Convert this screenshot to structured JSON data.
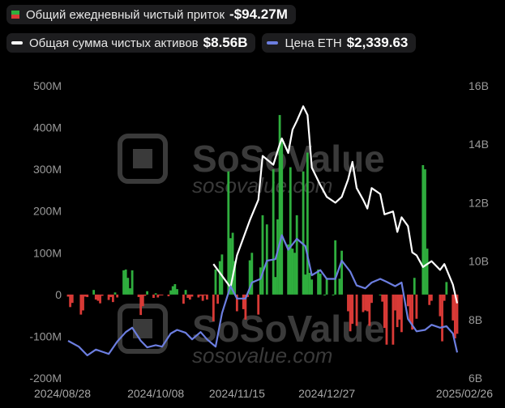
{
  "legend": {
    "flow": {
      "label": "Общий ежедневный чистый приток",
      "value": "-$94.27M",
      "color_pos": "#2fae3e",
      "color_neg": "#d93a36"
    },
    "assets": {
      "label": "Общая сумма чистых активов",
      "value": "$8.56B",
      "color": "#ffffff"
    },
    "price": {
      "label": "Цена ETH",
      "value": "$2,339.63",
      "color": "#6c7ee0"
    }
  },
  "watermark": {
    "brand": "SoSoValue",
    "url": "sosovalue.com"
  },
  "chart_data": {
    "type": "bar",
    "title": "",
    "x_tick_labels": [
      "2024/08/28",
      "2024/10/08",
      "2024/11/15",
      "2024/12/27",
      "2025/02/26"
    ],
    "left_axis": {
      "ticks": [
        "500M",
        "400M",
        "300M",
        "200M",
        "100M",
        "0",
        "-100M",
        "-200M"
      ],
      "ylim": [
        -200,
        500
      ],
      "unit": "M USD"
    },
    "right_axis": {
      "ticks": [
        "16B",
        "14B",
        "12B",
        "10B",
        "8B",
        "6B"
      ],
      "ylim": [
        6,
        16
      ],
      "unit": "B USD"
    },
    "grid": false,
    "series": [
      {
        "name": "Общий ежедневный чистый приток",
        "kind": "bar",
        "unit": "M USD",
        "x": [
          "2024-08-28",
          "2024-08-29",
          "2024-08-30",
          "2024-09-03",
          "2024-09-04",
          "2024-09-05",
          "2024-09-06",
          "2024-09-09",
          "2024-09-10",
          "2024-09-11",
          "2024-09-12",
          "2024-09-13",
          "2024-09-16",
          "2024-09-17",
          "2024-09-18",
          "2024-09-19",
          "2024-09-20",
          "2024-09-23",
          "2024-09-24",
          "2024-09-25",
          "2024-09-26",
          "2024-09-27",
          "2024-09-30",
          "2024-10-01",
          "2024-10-02",
          "2024-10-03",
          "2024-10-04",
          "2024-10-07",
          "2024-10-08",
          "2024-10-09",
          "2024-10-10",
          "2024-10-11",
          "2024-10-14",
          "2024-10-15",
          "2024-10-16",
          "2024-10-17",
          "2024-10-18",
          "2024-10-21",
          "2024-10-22",
          "2024-10-23",
          "2024-10-24",
          "2024-10-25",
          "2024-10-28",
          "2024-10-29",
          "2024-10-30",
          "2024-10-31",
          "2024-11-01",
          "2024-11-04",
          "2024-11-05",
          "2024-11-06",
          "2024-11-07",
          "2024-11-08",
          "2024-11-11",
          "2024-11-12",
          "2024-11-13",
          "2024-11-14",
          "2024-11-15",
          "2024-11-18",
          "2024-11-19",
          "2024-11-20",
          "2024-11-21",
          "2024-11-22",
          "2024-11-25",
          "2024-11-26",
          "2024-11-27",
          "2024-11-29",
          "2024-12-02",
          "2024-12-03",
          "2024-12-04",
          "2024-12-05",
          "2024-12-06",
          "2024-12-09",
          "2024-12-10",
          "2024-12-11",
          "2024-12-12",
          "2024-12-13",
          "2024-12-16",
          "2024-12-17",
          "2024-12-18",
          "2024-12-19",
          "2024-12-20",
          "2024-12-23",
          "2024-12-24",
          "2024-12-26",
          "2024-12-27",
          "2024-12-30",
          "2024-12-31",
          "2025-01-02",
          "2025-01-03",
          "2025-01-06",
          "2025-01-07",
          "2025-01-08",
          "2025-01-10",
          "2025-01-13",
          "2025-01-14",
          "2025-01-15",
          "2025-01-16",
          "2025-01-17",
          "2025-01-21",
          "2025-01-22",
          "2025-01-23",
          "2025-01-24",
          "2025-01-27",
          "2025-01-28",
          "2025-01-29",
          "2025-01-30",
          "2025-01-31",
          "2025-02-03",
          "2025-02-04",
          "2025-02-05",
          "2025-02-06",
          "2025-02-07",
          "2025-02-10",
          "2025-02-11",
          "2025-02-12",
          "2025-02-13",
          "2025-02-14",
          "2025-02-18",
          "2025-02-19",
          "2025-02-20",
          "2025-02-21",
          "2025-02-24",
          "2025-02-25",
          "2025-02-26"
        ],
        "values": [
          -5,
          -30,
          -20,
          -48,
          -38,
          -5,
          -6,
          11,
          -12,
          -15,
          -21,
          -3,
          -13,
          -6,
          -18,
          5,
          -7,
          58,
          60,
          40,
          15,
          58,
          -6,
          -49,
          -28,
          -3,
          8,
          -8,
          3,
          -7,
          -2,
          -1,
          -4,
          10,
          20,
          25,
          13,
          -22,
          11,
          -8,
          -12,
          -5,
          -7,
          -3,
          -15,
          -2,
          -12,
          -64,
          60,
          -22,
          80,
          96,
          295,
          135,
          148,
          80,
          -40,
          -35,
          -60,
          -6,
          82,
          100,
          -48,
          65,
          190,
          168,
          300,
          42,
          180,
          430,
          370,
          120,
          305,
          110,
          100,
          190,
          295,
          48,
          340,
          52,
          36,
          60,
          50,
          0,
          40,
          0,
          130,
          38,
          105,
          -40,
          -88,
          -70,
          -75,
          -42,
          -38,
          -40,
          -75,
          -20,
          0,
          -17,
          -80,
          -120,
          -120,
          -38,
          -78,
          -60,
          -90,
          -28,
          -65,
          -84,
          40,
          -58,
          310,
          300,
          110,
          -25,
          -15,
          -52,
          -112,
          -15,
          30,
          -62,
          -105,
          -94
        ]
      },
      {
        "name": "Общая сумма чистых активов",
        "kind": "line",
        "unit": "B USD",
        "x": [
          "2024-11-04",
          "2024-11-08",
          "2024-11-12",
          "2024-11-15",
          "2024-11-18",
          "2024-11-21",
          "2024-11-25",
          "2024-11-27",
          "2024-12-02",
          "2024-12-05",
          "2024-12-06",
          "2024-12-09",
          "2024-12-11",
          "2024-12-13",
          "2024-12-16",
          "2024-12-18",
          "2024-12-20",
          "2024-12-24",
          "2024-12-27",
          "2024-12-31",
          "2025-01-03",
          "2025-01-06",
          "2025-01-08",
          "2025-01-10",
          "2025-01-13",
          "2025-01-15",
          "2025-01-17",
          "2025-01-21",
          "2025-01-23",
          "2025-01-27",
          "2025-01-29",
          "2025-01-31",
          "2025-02-03",
          "2025-02-05",
          "2025-02-07",
          "2025-02-10",
          "2025-02-12",
          "2025-02-14",
          "2025-02-18",
          "2025-02-20",
          "2025-02-24",
          "2025-02-26"
        ],
        "values": [
          9.9,
          9.5,
          9.1,
          10.2,
          10.8,
          11.4,
          12.1,
          13.6,
          13.3,
          14.0,
          14.2,
          13.7,
          14.5,
          14.8,
          15.3,
          15.0,
          13.2,
          12.6,
          12.2,
          12.0,
          12.2,
          12.8,
          13.4,
          12.5,
          12.1,
          11.8,
          12.5,
          12.3,
          11.6,
          11.7,
          11.0,
          11.5,
          11.2,
          10.3,
          10.2,
          9.8,
          9.9,
          10.0,
          9.7,
          9.9,
          9.2,
          8.56
        ]
      },
      {
        "name": "Цена ETH",
        "kind": "line",
        "unit": "USD",
        "x": [
          "2024-08-28",
          "2024-09-02",
          "2024-09-06",
          "2024-09-10",
          "2024-09-16",
          "2024-09-20",
          "2024-09-24",
          "2024-09-27",
          "2024-10-01",
          "2024-10-04",
          "2024-10-08",
          "2024-10-11",
          "2024-10-15",
          "2024-10-18",
          "2024-10-22",
          "2024-10-25",
          "2024-10-29",
          "2024-11-01",
          "2024-11-05",
          "2024-11-08",
          "2024-11-12",
          "2024-11-15",
          "2024-11-19",
          "2024-11-22",
          "2024-11-26",
          "2024-11-29",
          "2024-12-03",
          "2024-12-06",
          "2024-12-09",
          "2024-12-13",
          "2024-12-17",
          "2024-12-20",
          "2024-12-24",
          "2024-12-27",
          "2024-12-31",
          "2025-01-03",
          "2025-01-07",
          "2025-01-10",
          "2025-01-14",
          "2025-01-17",
          "2025-01-21",
          "2025-01-24",
          "2025-01-28",
          "2025-01-31",
          "2025-02-03",
          "2025-02-07",
          "2025-02-11",
          "2025-02-14",
          "2025-02-18",
          "2025-02-21",
          "2025-02-24",
          "2025-02-26"
        ],
        "values": [
          2500,
          2420,
          2300,
          2380,
          2320,
          2490,
          2620,
          2680,
          2500,
          2410,
          2440,
          2420,
          2600,
          2650,
          2610,
          2520,
          2620,
          2520,
          2420,
          2880,
          3250,
          3080,
          3080,
          3300,
          3350,
          3600,
          3620,
          3950,
          3750,
          3900,
          3800,
          3400,
          3470,
          3350,
          3350,
          3600,
          3450,
          3260,
          3220,
          3300,
          3350,
          3310,
          3250,
          3300,
          2800,
          2630,
          2650,
          2720,
          2680,
          2700,
          2600,
          2339.63
        ]
      }
    ]
  }
}
